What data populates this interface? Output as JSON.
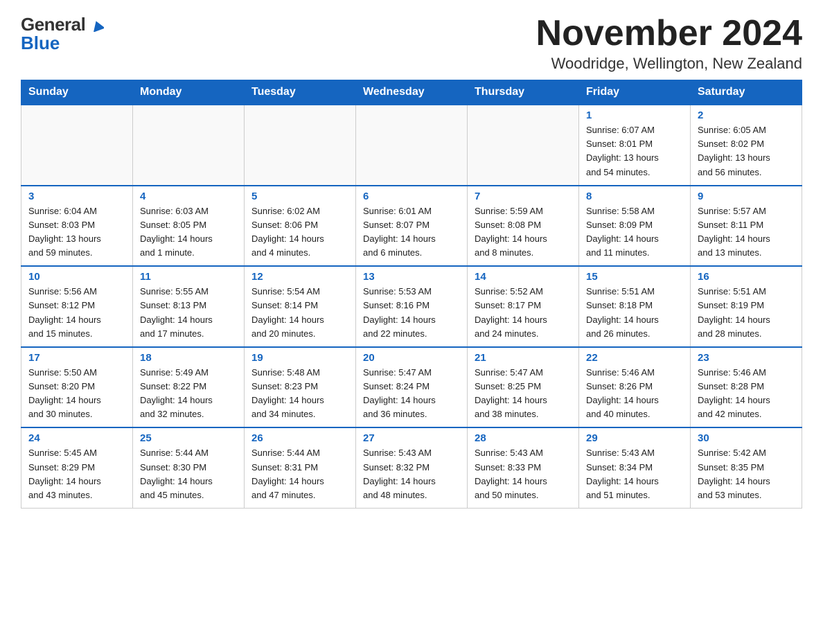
{
  "header": {
    "logo_general": "General",
    "logo_blue": "Blue",
    "month_title": "November 2024",
    "location": "Woodridge, Wellington, New Zealand"
  },
  "weekdays": [
    "Sunday",
    "Monday",
    "Tuesday",
    "Wednesday",
    "Thursday",
    "Friday",
    "Saturday"
  ],
  "weeks": [
    [
      {
        "day": "",
        "info": ""
      },
      {
        "day": "",
        "info": ""
      },
      {
        "day": "",
        "info": ""
      },
      {
        "day": "",
        "info": ""
      },
      {
        "day": "",
        "info": ""
      },
      {
        "day": "1",
        "info": "Sunrise: 6:07 AM\nSunset: 8:01 PM\nDaylight: 13 hours\nand 54 minutes."
      },
      {
        "day": "2",
        "info": "Sunrise: 6:05 AM\nSunset: 8:02 PM\nDaylight: 13 hours\nand 56 minutes."
      }
    ],
    [
      {
        "day": "3",
        "info": "Sunrise: 6:04 AM\nSunset: 8:03 PM\nDaylight: 13 hours\nand 59 minutes."
      },
      {
        "day": "4",
        "info": "Sunrise: 6:03 AM\nSunset: 8:05 PM\nDaylight: 14 hours\nand 1 minute."
      },
      {
        "day": "5",
        "info": "Sunrise: 6:02 AM\nSunset: 8:06 PM\nDaylight: 14 hours\nand 4 minutes."
      },
      {
        "day": "6",
        "info": "Sunrise: 6:01 AM\nSunset: 8:07 PM\nDaylight: 14 hours\nand 6 minutes."
      },
      {
        "day": "7",
        "info": "Sunrise: 5:59 AM\nSunset: 8:08 PM\nDaylight: 14 hours\nand 8 minutes."
      },
      {
        "day": "8",
        "info": "Sunrise: 5:58 AM\nSunset: 8:09 PM\nDaylight: 14 hours\nand 11 minutes."
      },
      {
        "day": "9",
        "info": "Sunrise: 5:57 AM\nSunset: 8:11 PM\nDaylight: 14 hours\nand 13 minutes."
      }
    ],
    [
      {
        "day": "10",
        "info": "Sunrise: 5:56 AM\nSunset: 8:12 PM\nDaylight: 14 hours\nand 15 minutes."
      },
      {
        "day": "11",
        "info": "Sunrise: 5:55 AM\nSunset: 8:13 PM\nDaylight: 14 hours\nand 17 minutes."
      },
      {
        "day": "12",
        "info": "Sunrise: 5:54 AM\nSunset: 8:14 PM\nDaylight: 14 hours\nand 20 minutes."
      },
      {
        "day": "13",
        "info": "Sunrise: 5:53 AM\nSunset: 8:16 PM\nDaylight: 14 hours\nand 22 minutes."
      },
      {
        "day": "14",
        "info": "Sunrise: 5:52 AM\nSunset: 8:17 PM\nDaylight: 14 hours\nand 24 minutes."
      },
      {
        "day": "15",
        "info": "Sunrise: 5:51 AM\nSunset: 8:18 PM\nDaylight: 14 hours\nand 26 minutes."
      },
      {
        "day": "16",
        "info": "Sunrise: 5:51 AM\nSunset: 8:19 PM\nDaylight: 14 hours\nand 28 minutes."
      }
    ],
    [
      {
        "day": "17",
        "info": "Sunrise: 5:50 AM\nSunset: 8:20 PM\nDaylight: 14 hours\nand 30 minutes."
      },
      {
        "day": "18",
        "info": "Sunrise: 5:49 AM\nSunset: 8:22 PM\nDaylight: 14 hours\nand 32 minutes."
      },
      {
        "day": "19",
        "info": "Sunrise: 5:48 AM\nSunset: 8:23 PM\nDaylight: 14 hours\nand 34 minutes."
      },
      {
        "day": "20",
        "info": "Sunrise: 5:47 AM\nSunset: 8:24 PM\nDaylight: 14 hours\nand 36 minutes."
      },
      {
        "day": "21",
        "info": "Sunrise: 5:47 AM\nSunset: 8:25 PM\nDaylight: 14 hours\nand 38 minutes."
      },
      {
        "day": "22",
        "info": "Sunrise: 5:46 AM\nSunset: 8:26 PM\nDaylight: 14 hours\nand 40 minutes."
      },
      {
        "day": "23",
        "info": "Sunrise: 5:46 AM\nSunset: 8:28 PM\nDaylight: 14 hours\nand 42 minutes."
      }
    ],
    [
      {
        "day": "24",
        "info": "Sunrise: 5:45 AM\nSunset: 8:29 PM\nDaylight: 14 hours\nand 43 minutes."
      },
      {
        "day": "25",
        "info": "Sunrise: 5:44 AM\nSunset: 8:30 PM\nDaylight: 14 hours\nand 45 minutes."
      },
      {
        "day": "26",
        "info": "Sunrise: 5:44 AM\nSunset: 8:31 PM\nDaylight: 14 hours\nand 47 minutes."
      },
      {
        "day": "27",
        "info": "Sunrise: 5:43 AM\nSunset: 8:32 PM\nDaylight: 14 hours\nand 48 minutes."
      },
      {
        "day": "28",
        "info": "Sunrise: 5:43 AM\nSunset: 8:33 PM\nDaylight: 14 hours\nand 50 minutes."
      },
      {
        "day": "29",
        "info": "Sunrise: 5:43 AM\nSunset: 8:34 PM\nDaylight: 14 hours\nand 51 minutes."
      },
      {
        "day": "30",
        "info": "Sunrise: 5:42 AM\nSunset: 8:35 PM\nDaylight: 14 hours\nand 53 minutes."
      }
    ]
  ]
}
